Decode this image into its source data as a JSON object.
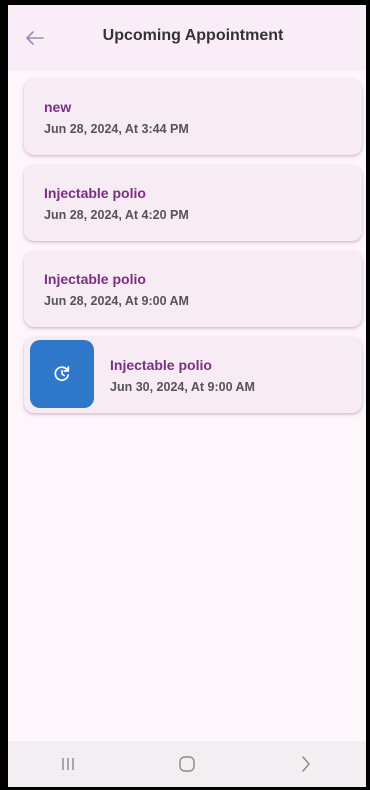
{
  "header": {
    "title": "Upcoming Appointment",
    "back_icon": "arrow-left-icon"
  },
  "appointments": [
    {
      "name": "new",
      "datetime": "Jun 28, 2024,  At 3:44 PM"
    },
    {
      "name": "Injectable polio",
      "datetime": "Jun 28, 2024,  At 4:20 PM"
    },
    {
      "name": "Injectable polio",
      "datetime": "Jun 28, 2024,  At 9:00 AM"
    },
    {
      "name": "Injectable polio",
      "datetime": "Jun 30, 2024,  At 9:00 AM",
      "swipe_action_icon": "reschedule-icon"
    }
  ],
  "system_nav": {
    "recents_icon": "recents-icon",
    "home_icon": "home-icon",
    "back_icon": "chevron-right-icon"
  },
  "colors": {
    "accent": "#7b2f83",
    "swipe_action": "#2f78c9",
    "background": "#fdf6fb",
    "card": "#f7ebf4"
  }
}
